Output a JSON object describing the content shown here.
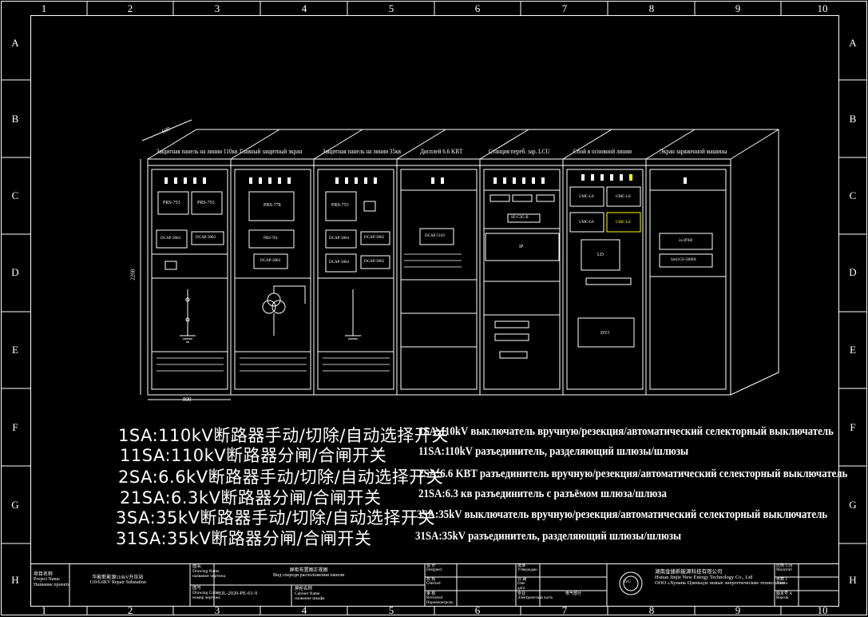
{
  "frame": {
    "columns": [
      "1",
      "2",
      "3",
      "4",
      "5",
      "6",
      "7",
      "8",
      "9",
      "10"
    ],
    "rows": [
      "A",
      "B",
      "C",
      "D",
      "E",
      "F",
      "G",
      "H"
    ]
  },
  "panels": [
    {
      "header": "Защитная панель на линии 110кв",
      "screens": [
        "PRS-753",
        "PRS-753"
      ],
      "ids": [
        "DCAP-3064",
        "DCAP-3062"
      ]
    },
    {
      "header": "Главный защитный экран",
      "screens": [
        "PRS-778",
        "PRS-761"
      ],
      "ids": [
        "DCAP-3064"
      ]
    },
    {
      "header": "Защитная панель на линии 35кв",
      "screens": [
        "PRS-753"
      ],
      "ids": [
        "DCAP-3064",
        "DCAP-3062",
        "DCAP-3064",
        "DCAP-3062"
      ]
    },
    {
      "header": "Дисплей 6.6 KBT",
      "screens": [
        "DCAP-5103"
      ],
      "ids": []
    },
    {
      "header": "Станция переб. зар. LCU",
      "screens": [
        "IP"
      ],
      "ids": [
        "SF-C3G-B"
      ]
    },
    {
      "header": "Сбой в основной линии",
      "screens": [
        "LD",
        "DVJ"
      ],
      "ids": [
        "UMC-L8",
        "UMC-L8",
        "UMC-L8",
        "UMC-L8"
      ]
    },
    {
      "header": "Экран заряженной машины",
      "screens": [
        "2a IPXR",
        "SmGGS-5000X"
      ],
      "ids": []
    }
  ],
  "notes_cn": [
    "1SA:110kV断路器手动/切除/自动选择开关",
    "11SA:110kV断路器分闸/合闸开关",
    "2SA:6.6kV断路器手动/切除/自动选择开关",
    "21SA:6.3kV断路器分闸/合闸开关",
    "3SA:35kV断路器手动/切除/自动选择开关",
    "31SA:35kV断路器分闸/合闸开关"
  ],
  "notes_ru": [
    "1SA:110kV выключатель вручную/резекция/автоматический селекторный выключатель",
    "11SA:110kV разъединитель, разделяющий шлюзы/шлюзы",
    "2SA:6.6 KBT разъединитель вручную/резекция/автоматический селекторный выключатель",
    "21SA:6.3 кв разъединитель с разъёмом шлюза/шлюза",
    "3SA:35kV выключатель вручную/резекция/автоматический селекторный выключатель",
    "31SA:35kV разъединитель, разделяющий шлюзы/шлюзы"
  ],
  "title_block": {
    "project_label_cn": "项目名称",
    "project_label_en": "Project Name",
    "project_label_ru": "Название проекта",
    "project_value_1": "华能新能源110kV升压站",
    "project_value_2": "110/6.6KV Repair Substation",
    "drawing_name_label_cn": "图名",
    "drawing_name_label_en": "Drawing Name",
    "drawing_name_label_ru": "название чертежа",
    "drawing_name_value_1": "屏柜布置图正视图",
    "drawing_name_value_2": "Вид спереди расположения панели",
    "drawing_code_label_cn": "图号",
    "drawing_code_label_en": "Drawing Code",
    "drawing_code_label_ru": "номер чертежа",
    "drawing_code_value": "HJL-2020-PE-01-9",
    "content_label_cn": "屏柜名称",
    "content_label_en": "Cabinet Name",
    "content_label_ru": "название шкафа",
    "designed_label_cn": "设 计",
    "designed_label_en": "Designed",
    "designed_label_ru": "Разработал",
    "checked_label_cn": "校 核",
    "checked_label_en": "Checked",
    "checked_label_ru": "Проверил",
    "reviewed_label_cn": "审 核",
    "reviewed_label_en": "Reviewed",
    "reviewed_label_ru": "Нормоконтроль",
    "approved_label_cn": "批准",
    "approved_label_en": "Approved",
    "approved_label_ru": "Утверждаю",
    "date_label_cn": "日 期",
    "date_label_en": "Date",
    "date_label_ru": "дата",
    "specialty_label_cn": "专业",
    "specialty_value": "电气部分",
    "specialty_label_ru": "Электрическая часть",
    "company_cn": "湖南金捷新能源科技有限公司",
    "company_en": "Hunan Jinjie New Energy Technology Co., Ltd",
    "company_ru": "ООО «Хунань Цзиньцзе новые энергетические технологии»",
    "scale_label_cn": "比例",
    "scale_label_en": "Scale",
    "scale_label_ru": "Масштаб",
    "scale_value": "1:20",
    "sheet_label_cn": "张数",
    "sheet_label_en": "Sheet",
    "sheet_label_ru": "Лист",
    "sheet_value": "1",
    "version_label_cn": "版本号",
    "version_label_en": "Version",
    "version_label_ru": "Версия",
    "version_value": "A"
  },
  "dimensions": {
    "width": "800",
    "height": "2260",
    "depth": "600"
  },
  "colors": {
    "line": "#ffffff",
    "highlight": "#ffff00",
    "background": "#000000"
  }
}
